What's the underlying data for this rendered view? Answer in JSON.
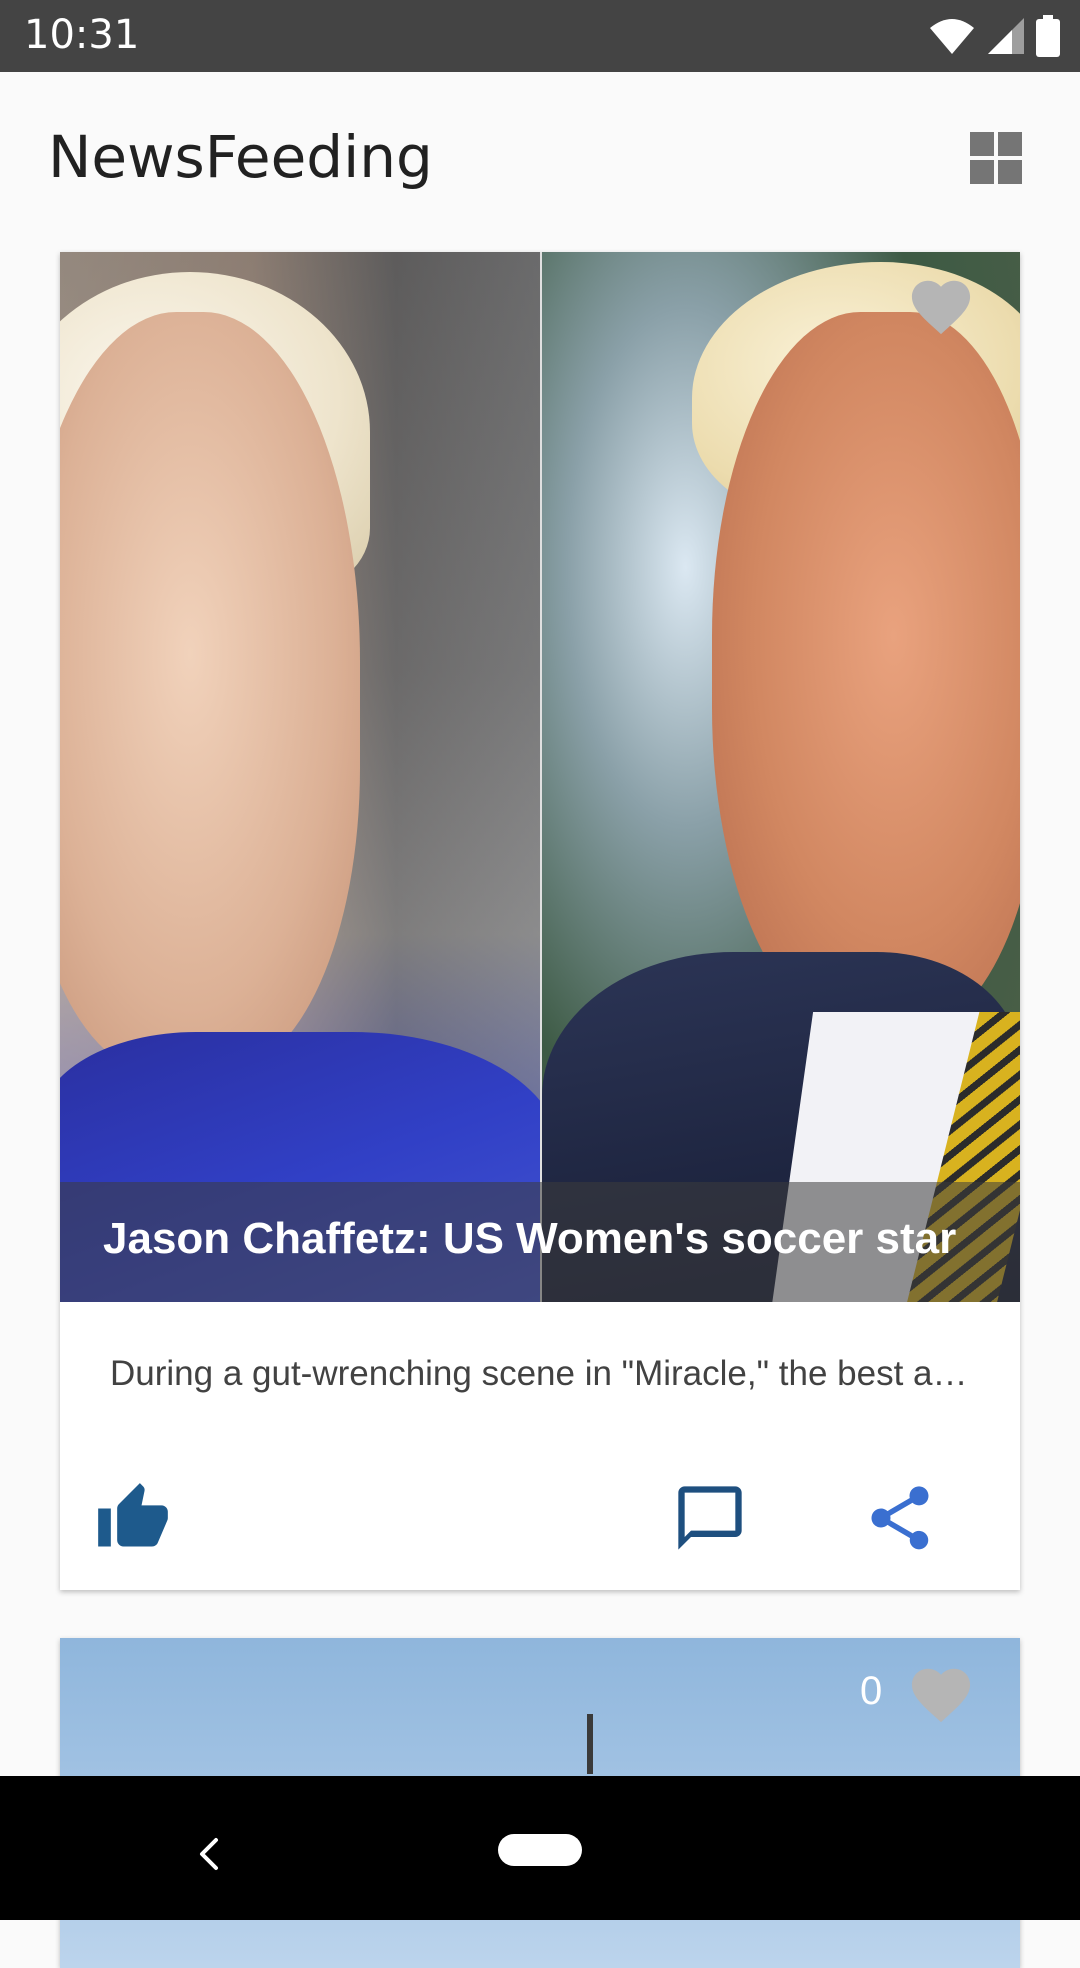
{
  "status_bar": {
    "time": "10:31",
    "icons": [
      "wifi-icon",
      "cell-signal-icon",
      "battery-icon"
    ]
  },
  "app_bar": {
    "title": "NewsFeeding",
    "layout_toggle_icon": "grid-view-icon"
  },
  "feed": {
    "cards": [
      {
        "title": "Jason Chaffetz: US Women's soccer star",
        "snippet": "During a gut-wrenching scene in \"Miracle,\" the best a…",
        "favorite_icon": "heart-icon",
        "actions": {
          "like_icon": "thumb-up-icon",
          "comment_icon": "comment-icon",
          "share_icon": "share-icon"
        }
      },
      {
        "like_count": "0",
        "favorite_icon": "heart-icon"
      }
    ]
  },
  "colors": {
    "status_bar_bg": "#444444",
    "page_bg": "#fafafa",
    "like_icon": "#1e5a8c",
    "comment_icon": "#1e4f7f",
    "share_icon": "#3a6fd0",
    "heart_icon": "#b5b5b5"
  },
  "nav_bar": {
    "back_icon": "back-icon",
    "home_icon": "home-pill-icon"
  }
}
